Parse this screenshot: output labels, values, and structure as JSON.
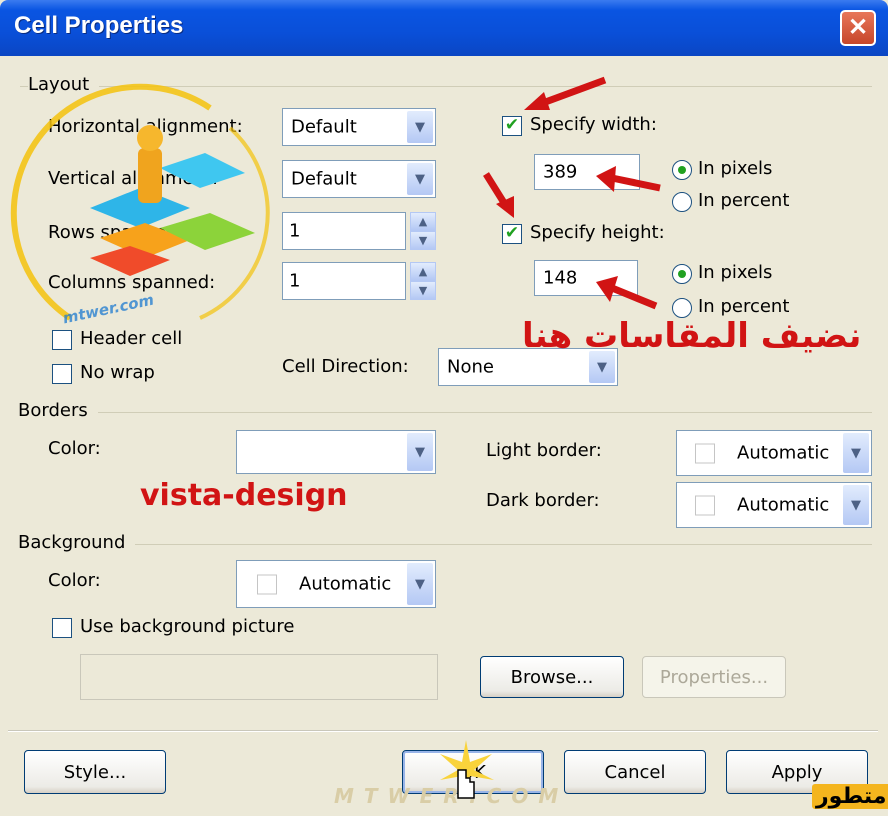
{
  "window": {
    "title": "Cell Properties",
    "close_glyph": "✕"
  },
  "layout": {
    "group_label": "Layout",
    "horizontal_alignment": {
      "label": "Horizontal alignment:",
      "value": "Default"
    },
    "vertical_alignment": {
      "label": "Vertical alignment:",
      "value": "Default"
    },
    "rows_spanned": {
      "label": "Rows spanned:",
      "value": "1"
    },
    "columns_spanned": {
      "label": "Columns spanned:",
      "value": "1"
    },
    "specify_width": {
      "label": "Specify width:",
      "checked": true,
      "value": "389",
      "in_pixels": "In pixels",
      "in_percent": "In percent",
      "unit": "pixels"
    },
    "specify_height": {
      "label": "Specify height:",
      "checked": true,
      "value": "148",
      "in_pixels": "In pixels",
      "in_percent": "In percent",
      "unit": "pixels"
    },
    "header_cell": {
      "label": "Header cell",
      "checked": false
    },
    "no_wrap": {
      "label": "No wrap",
      "checked": false
    },
    "cell_direction": {
      "label": "Cell Direction:",
      "value": "None"
    }
  },
  "borders": {
    "group_label": "Borders",
    "color": {
      "label": "Color:",
      "value": ""
    },
    "light_border": {
      "label": "Light border:",
      "value": "Automatic"
    },
    "dark_border": {
      "label": "Dark border:",
      "value": "Automatic"
    }
  },
  "background": {
    "group_label": "Background",
    "color": {
      "label": "Color:",
      "value": "Automatic"
    },
    "use_picture": {
      "label": "Use background picture",
      "checked": false
    },
    "picture_path": "",
    "browse_label": "Browse...",
    "properties_label": "Properties..."
  },
  "footer": {
    "style_label": "Style...",
    "ok_label": "OK",
    "cancel_label": "Cancel",
    "apply_label": "Apply"
  },
  "annotations": {
    "arabic_note": "نضيف المقاسات هنا",
    "vista_design": "vista-design",
    "watermark_bottom": "MTWER.COM",
    "watermark_logo": "mtwer.com",
    "corner_logo": "متطور"
  },
  "colors": {
    "title_bar": "#0A55E2",
    "dialog_bg": "#ECE9D8",
    "annotation_red": "#D11414",
    "check_green": "#21A121"
  }
}
